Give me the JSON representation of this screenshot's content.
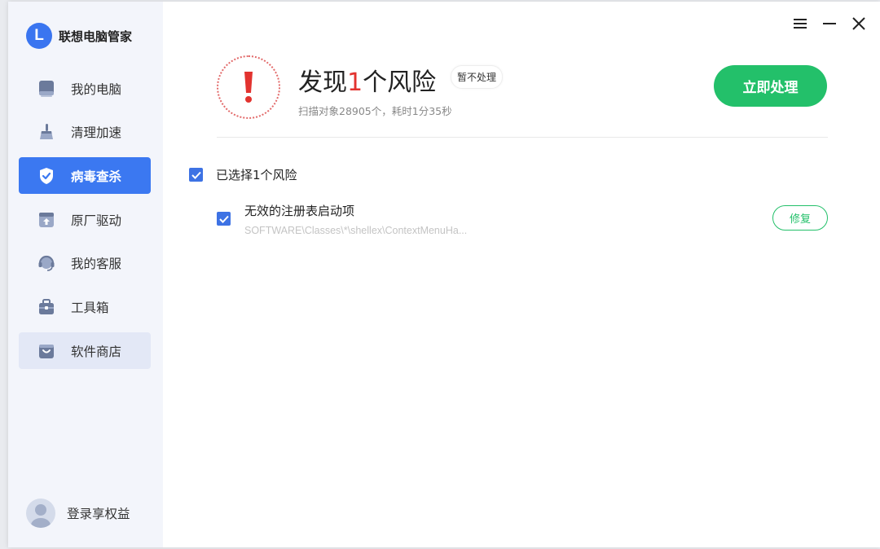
{
  "app": {
    "name": "联想电脑管家",
    "logo_letter": "L"
  },
  "sidebar": {
    "items": [
      {
        "label": "我的电脑",
        "icon": "computer-icon",
        "state": "normal"
      },
      {
        "label": "清理加速",
        "icon": "broom-icon",
        "state": "normal"
      },
      {
        "label": "病毒查杀",
        "icon": "shield-icon",
        "state": "active"
      },
      {
        "label": "原厂驱动",
        "icon": "driver-upload-icon",
        "state": "normal"
      },
      {
        "label": "我的客服",
        "icon": "headset-icon",
        "state": "normal"
      },
      {
        "label": "工具箱",
        "icon": "toolbox-icon",
        "state": "normal"
      },
      {
        "label": "软件商店",
        "icon": "shopping-bag-icon",
        "state": "hover"
      }
    ],
    "user_label": "登录享权益"
  },
  "window_controls": [
    "menu-icon",
    "minimize-icon",
    "close-icon"
  ],
  "result": {
    "title_prefix": "发现",
    "count": "1",
    "title_suffix": "个风险",
    "ignore_label": "暂不处理",
    "subtitle": "扫描对象28905个，耗时1分35秒",
    "action_label": "立即处理"
  },
  "selection": {
    "all_label": "已选择1个风险",
    "all_checked": true
  },
  "risks": [
    {
      "title": "无效的注册表启动项",
      "path": "SOFTWARE\\Classes\\*\\shellex\\ContextMenuHa...",
      "checked": true,
      "action_label": "修复"
    }
  ],
  "colors": {
    "accent_blue": "#3b78f1",
    "success_green": "#23c06a",
    "danger_red": "#e2332f",
    "sidebar_bg": "#f3f5fb"
  }
}
